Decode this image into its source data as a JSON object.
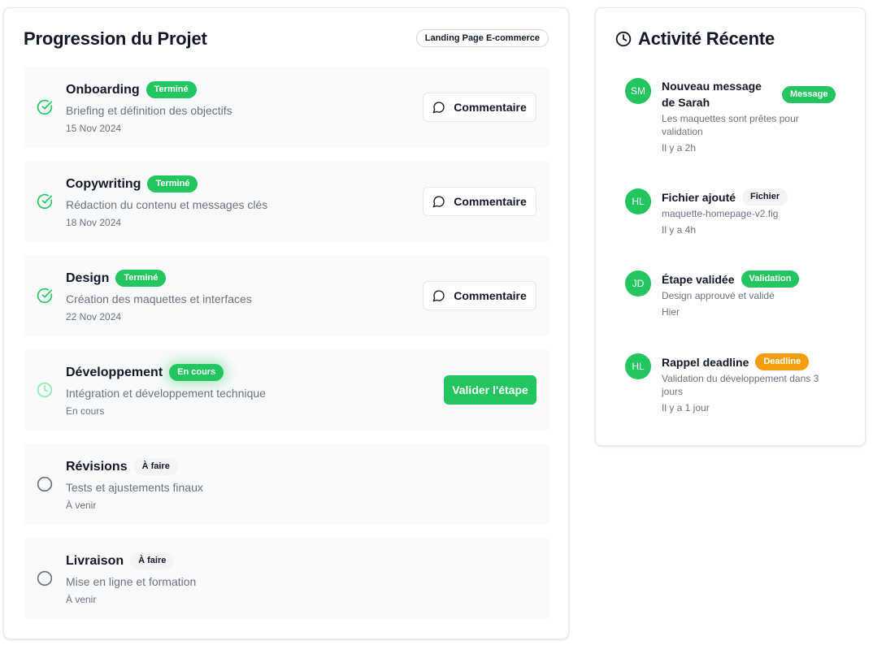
{
  "progress": {
    "title": "Progression du Projet",
    "project_badge": "Landing Page E-commerce",
    "steps": [
      {
        "name": "Onboarding",
        "status": "Terminé",
        "description": "Briefing et définition des objectifs",
        "date": "15 Nov 2024",
        "action": "Commentaire",
        "icon": "check-circle-icon"
      },
      {
        "name": "Copywriting",
        "status": "Terminé",
        "description": "Rédaction du contenu et messages clés",
        "date": "18 Nov 2024",
        "action": "Commentaire",
        "icon": "check-circle-icon"
      },
      {
        "name": "Design",
        "status": "Terminé",
        "description": "Création des maquettes et interfaces",
        "date": "22 Nov 2024",
        "action": "Commentaire",
        "icon": "check-circle-icon"
      },
      {
        "name": "Développement",
        "status": "En cours",
        "description": "Intégration et développement technique",
        "date": "En cours",
        "action": "Valider l'étape",
        "icon": "clock-icon"
      },
      {
        "name": "Révisions",
        "status": "À faire",
        "description": "Tests et ajustements finaux",
        "date": "À venir",
        "icon": "empty-circle-icon"
      },
      {
        "name": "Livraison",
        "status": "À faire",
        "description": "Mise en ligne et formation",
        "date": "À venir",
        "icon": "empty-circle-icon"
      }
    ]
  },
  "activity": {
    "title": "Activité Récente",
    "icon": "clock-icon",
    "items": [
      {
        "initials": "SM",
        "title": "Nouveau message de Sarah",
        "badge": "Message",
        "description": "Les maquettes sont prêtes pour validation",
        "time": "Il y a 2h"
      },
      {
        "initials": "HL",
        "title": "Fichier ajouté",
        "badge": "Fichier",
        "description": "maquette-homepage-v2.fig",
        "time": "Il y a 4h"
      },
      {
        "initials": "JD",
        "title": "Étape validée",
        "badge": "Validation",
        "description": "Design approuvé et validé",
        "time": "Hier"
      },
      {
        "initials": "HL",
        "title": "Rappel deadline",
        "badge": "Deadline",
        "description": "Validation du développement dans 3 jours",
        "time": "Il y a 1 jour"
      }
    ]
  },
  "colors": {
    "accent": "#22c55e",
    "accent_light": "#86efac",
    "warning": "#f59e0b",
    "muted_text": "#6b7280",
    "step_bg": "#f9fafb",
    "neutral_badge": "#f3f4f6"
  }
}
